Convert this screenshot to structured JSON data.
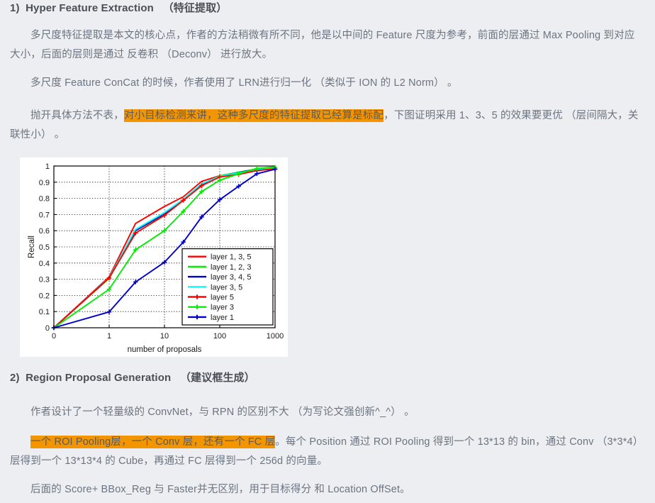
{
  "page": {
    "background_color": "#edeef2",
    "text_color": "#6b7480",
    "highlight_color": "#f29500"
  },
  "sections": [
    {
      "number": "1)",
      "title_en": "Hyper Feature Extraction",
      "title_cn": "（特征提取）"
    },
    {
      "number": "2)",
      "title_en": "Region Proposal Generation",
      "title_cn": "（建议框生成）"
    }
  ],
  "paragraphs": {
    "p1": "多尺度特征提取是本文的核心点，作者的方法稍微有所不同，他是以中间的 Feature 尺度为参考，前面的层通过 Max Pooling 到对应大小，后面的层则是通过 反卷积 （Deconv） 进行放大。",
    "p2": "多尺度 Feature ConCat 的时候，作者使用了 LRN进行归一化 （类似于 ION 的 L2 Norm） 。",
    "p3_before": "抛开具体方法不表，",
    "p3_highlight": "对小目标检测来讲，这种多尺度的特征提取已经算是标配",
    "p3_after": "，下图证明采用 1、3、5 的效果要更优 （层间隔大，关联性小） 。",
    "p4": "作者设计了一个轻量级的 ConvNet，与 RPN 的区别不大 （为写论文强创新^_^） 。",
    "p5_highlight": "一个 ROI Pooling层，一个 Conv 层，还有一个 FC 层",
    "p5_after": "。每个 Position 通过 ROI Pooling 得到一个 13*13 的 bin，通过 Conv （3*3*4） 层得到一个 13*13*4 的 Cube，再通过 FC 层得到一个 256d 的向量。",
    "p6": "后面的 Score+ BBox_Reg 与 Faster并无区别，用于目标得分 和 Location OffSet。"
  },
  "chart_data": {
    "type": "line",
    "title": "",
    "xlabel": "number of proposals",
    "ylabel": "Recall",
    "xscale": "log-like",
    "xtick_labels": [
      "0",
      "1",
      "10",
      "100",
      "1000"
    ],
    "xtick_values": [
      0,
      1,
      10,
      100,
      1000
    ],
    "ytick_labels": [
      "0",
      "0.1",
      "0.2",
      "0.3",
      "0.4",
      "0.5",
      "0.6",
      "0.7",
      "0.8",
      "0.9",
      "1"
    ],
    "ylim": [
      0,
      1
    ],
    "grid": true,
    "legend_position": "lower-right",
    "x": [
      0,
      1,
      3,
      10,
      22,
      47,
      100,
      220,
      470,
      1000
    ],
    "series": [
      {
        "name": "layer 1, 3, 5",
        "color": "#ff0000",
        "marker": "none",
        "values": [
          0.0,
          0.315,
          0.645,
          0.75,
          0.81,
          0.905,
          0.94,
          0.955,
          0.975,
          0.985
        ]
      },
      {
        "name": "layer 1, 2, 3",
        "color": "#00ee00",
        "marker": "none",
        "values": [
          0.0,
          0.305,
          0.6,
          0.7,
          0.79,
          0.885,
          0.94,
          0.962,
          0.982,
          0.995
        ]
      },
      {
        "name": "layer 3, 4, 5",
        "color": "#0000cc",
        "marker": "none",
        "values": [
          0.0,
          0.31,
          0.6,
          0.705,
          0.79,
          0.888,
          0.935,
          0.96,
          0.98,
          0.988
        ]
      },
      {
        "name": "layer 3, 5",
        "color": "#00ffff",
        "marker": "none",
        "values": [
          0.0,
          0.31,
          0.608,
          0.712,
          0.795,
          0.89,
          0.936,
          0.958,
          0.978,
          0.988
        ]
      },
      {
        "name": "layer 5",
        "color": "#ff0000",
        "marker": "plus",
        "values": [
          0.0,
          0.308,
          0.585,
          0.695,
          0.788,
          0.878,
          0.932,
          0.948,
          0.972,
          0.982
        ]
      },
      {
        "name": "layer 3",
        "color": "#00ee00",
        "marker": "plus",
        "values": [
          0.0,
          0.238,
          0.482,
          0.6,
          0.72,
          0.842,
          0.912,
          0.952,
          0.985,
          0.992
        ]
      },
      {
        "name": "layer 1",
        "color": "#0000cc",
        "marker": "plus",
        "values": [
          0.0,
          0.098,
          0.283,
          0.405,
          0.53,
          0.685,
          0.792,
          0.875,
          0.952,
          0.98
        ]
      }
    ]
  }
}
